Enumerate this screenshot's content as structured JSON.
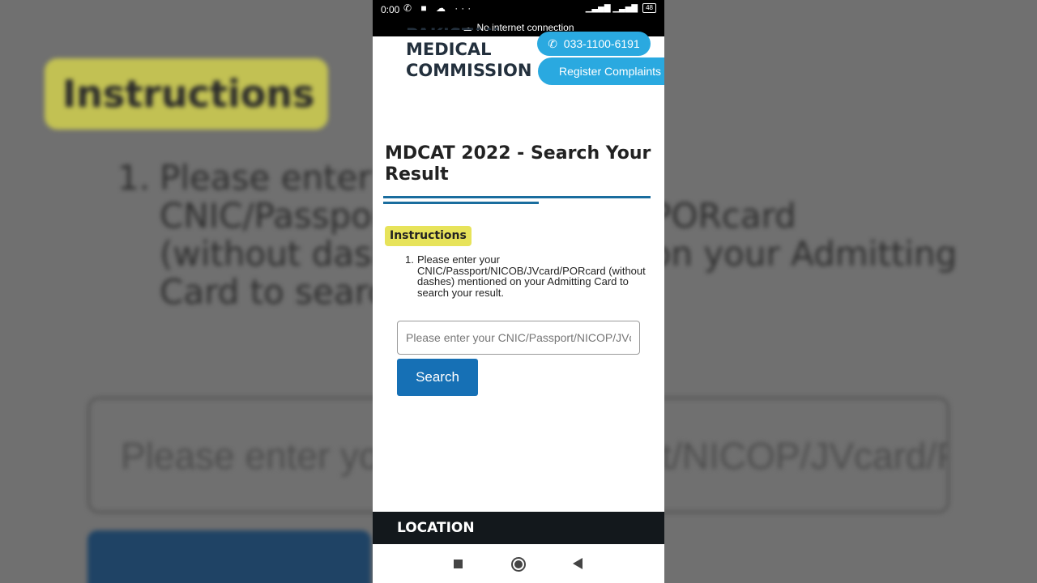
{
  "status_bar": {
    "time": "0:00",
    "notifications": "✆ ■ ☁  ···",
    "signal": "▁▃▅▇ ▁▃▅▇",
    "battery": "48",
    "connection_text": "No internet connection"
  },
  "header": {
    "logo_line1": "PAKISTAN",
    "logo_line2": "MEDICAL",
    "logo_line3": "COMMISSION",
    "phone": "033-1100-6191",
    "register": "Register Complaints"
  },
  "page": {
    "title": "MDCAT 2022 - Search Your Result",
    "instructions_label": "Instructions",
    "instruction_number": "1.",
    "instruction_text": "Please enter your CNIC/Passport/NICOB/JVcard/PORcard (without dashes) mentioned on your Admitting Card to search your result."
  },
  "search": {
    "placeholder": "Please enter your CNIC/Passport/NICOP/JVcard/PORcard",
    "button_label": "Search"
  },
  "footer": {
    "location_label": "LOCATION"
  },
  "background": {
    "instructions_label": "Instructions",
    "instruction_number": "1.",
    "instruction_text": "Please enter your\nCNIC/Passport/NICOB/JVcard/PORcard\n(without dashes) mentioned on your Admitting\nCard to search your result.",
    "input_text": "Please enter your CNIC/Passport/NICOP/JVcard/PORcard"
  },
  "colors": {
    "accent": "#1670b5",
    "pill": "#2aa9e0",
    "badge": "#e7e35a",
    "footer": "#13181c"
  }
}
